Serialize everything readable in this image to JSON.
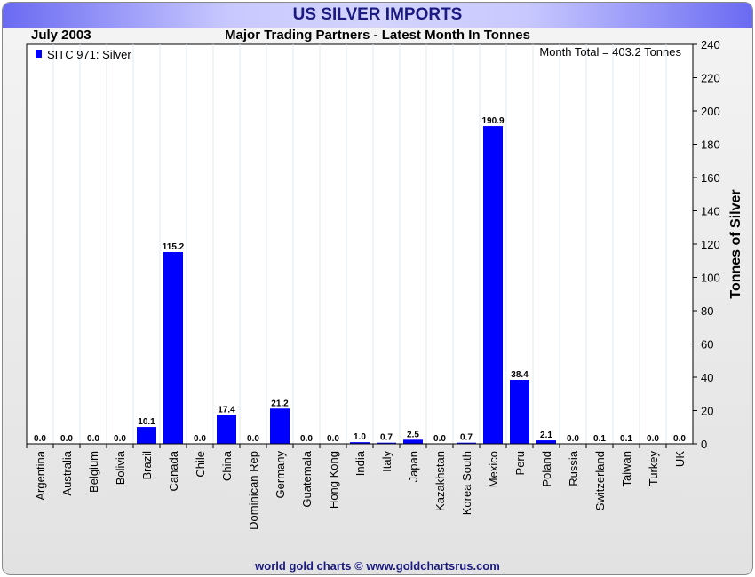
{
  "header": {
    "title": "US SILVER IMPORTS",
    "date": "July 2003",
    "footer": "world gold charts © www.goldchartsrus.com"
  },
  "colors": {
    "bar": "#0000ff",
    "title": "#1a1a80"
  },
  "chart_data": {
    "type": "bar",
    "title": "Major Trading Partners - Latest Month In Tonnes",
    "legend": "SITC 971: Silver",
    "legend_position": "top-left",
    "annotation": "Month Total = 403.2 Tonnes",
    "ylabel": "Tonnes of Silver",
    "xlabel": "",
    "ylim": [
      0,
      240
    ],
    "yticks": [
      0,
      20,
      40,
      60,
      80,
      100,
      120,
      140,
      160,
      180,
      200,
      220,
      240
    ],
    "categories": [
      "Argentina",
      "Australia",
      "Belgium",
      "Bolivia",
      "Brazil",
      "Canada",
      "Chile",
      "China",
      "Dominican Rep",
      "Germany",
      "Guatemala",
      "Hong Kong",
      "India",
      "Italy",
      "Japan",
      "Kazakhstan",
      "Korea South",
      "Mexico",
      "Peru",
      "Poland",
      "Russia",
      "Switzerland",
      "Taiwan",
      "Turkey",
      "UK"
    ],
    "values": [
      0.0,
      0.0,
      0.0,
      0.0,
      10.1,
      115.2,
      0.0,
      17.4,
      0.0,
      21.2,
      0.0,
      0.0,
      1.0,
      0.7,
      2.5,
      0.0,
      0.7,
      190.9,
      38.4,
      2.1,
      0.0,
      0.1,
      0.1,
      0.0,
      0.0
    ],
    "labels": [
      "0.0",
      "0.0",
      "0.0",
      "0.0",
      "10.1",
      "115.2",
      "0.0",
      "17.4",
      "0.0",
      "21.2",
      "0.0",
      "0.0",
      "1.0",
      "0.7",
      "2.5",
      "0.0",
      "0.7",
      "190.9",
      "38.4",
      "2.1",
      "0.0",
      "0.1",
      "0.1",
      "0.0",
      "0.0"
    ]
  }
}
